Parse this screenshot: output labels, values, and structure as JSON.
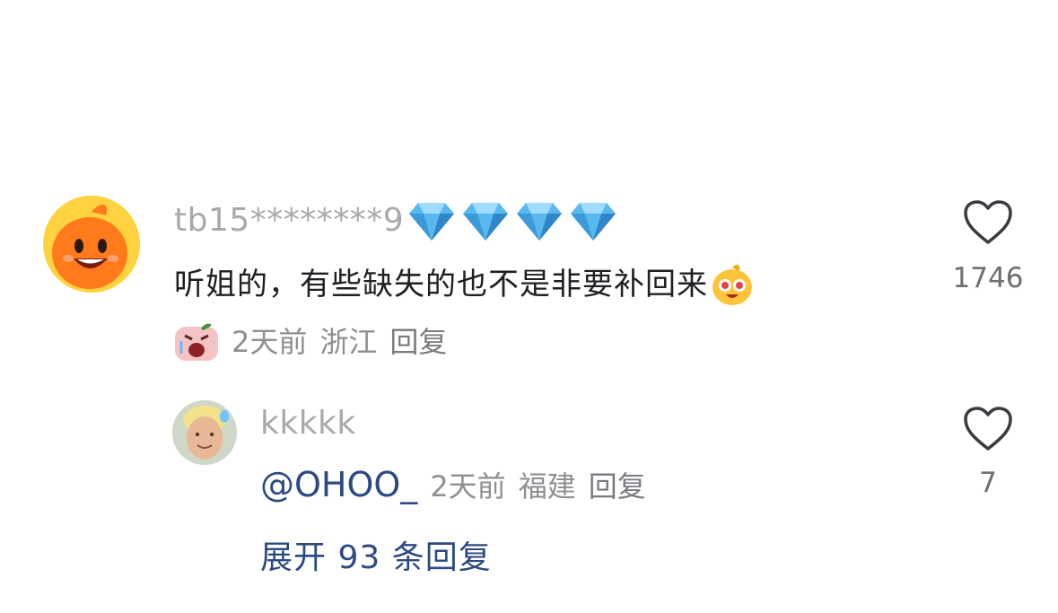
{
  "comment": {
    "username": "tb15********9",
    "badge_icons": [
      "diamond-icon",
      "diamond-icon",
      "diamond-icon",
      "diamond-icon"
    ],
    "text": "听姐的，有些缺失的也不是非要补回来",
    "time": "2天前",
    "location": "浙江",
    "reply_label": "回复",
    "like_count": "1746"
  },
  "reply": {
    "username": "kkkkk",
    "mention": "@OHOO_",
    "time": "2天前",
    "location": "福建",
    "reply_label": "回复",
    "like_count": "7"
  },
  "expand_label": "展开 93 条回复",
  "colors": {
    "link": "#2d4a80",
    "diamond": "#5ab8f0",
    "avatar_bg": "#ffd23f",
    "mascot": "#ff7a1a"
  }
}
